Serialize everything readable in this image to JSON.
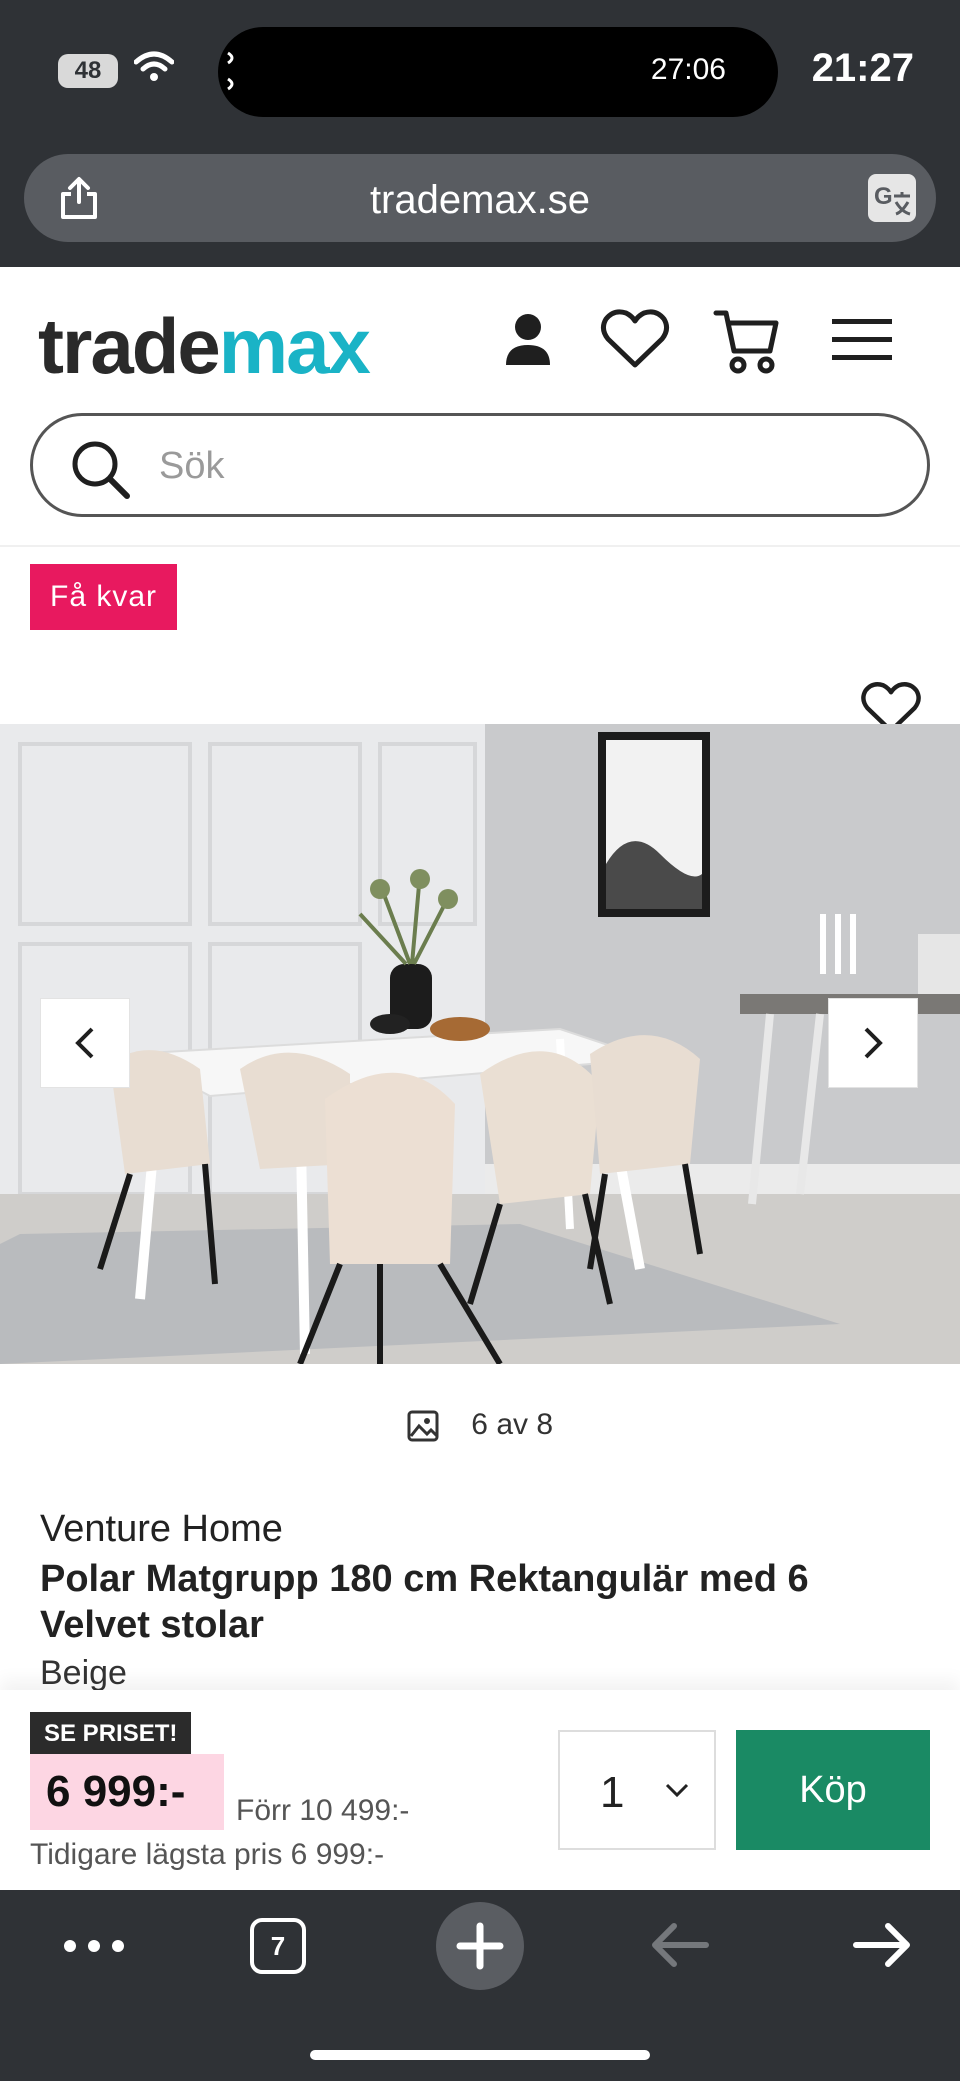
{
  "status": {
    "battery": "48",
    "island_time": "27:06",
    "clock": "21:27"
  },
  "browser": {
    "url": "trademax.se"
  },
  "header": {
    "logo_part1": "trade",
    "logo_part2": "max",
    "search_placeholder": "Sök"
  },
  "product": {
    "badge": "Få kvar",
    "gallery_counter": "6 av 8",
    "brand": "Venture Home",
    "title": "Polar Matgrupp 180 cm Rektangulär med 6 Velvet stolar",
    "color": "Beige"
  },
  "buy_bar": {
    "tag": "SE PRISET!",
    "price": "6 999:-",
    "before_price": "Förr 10 499:-",
    "lowest_price": "Tidigare lägsta pris 6 999:-",
    "quantity": "1",
    "buy_label": "Köp"
  },
  "bottom_bar": {
    "tab_count": "7"
  }
}
